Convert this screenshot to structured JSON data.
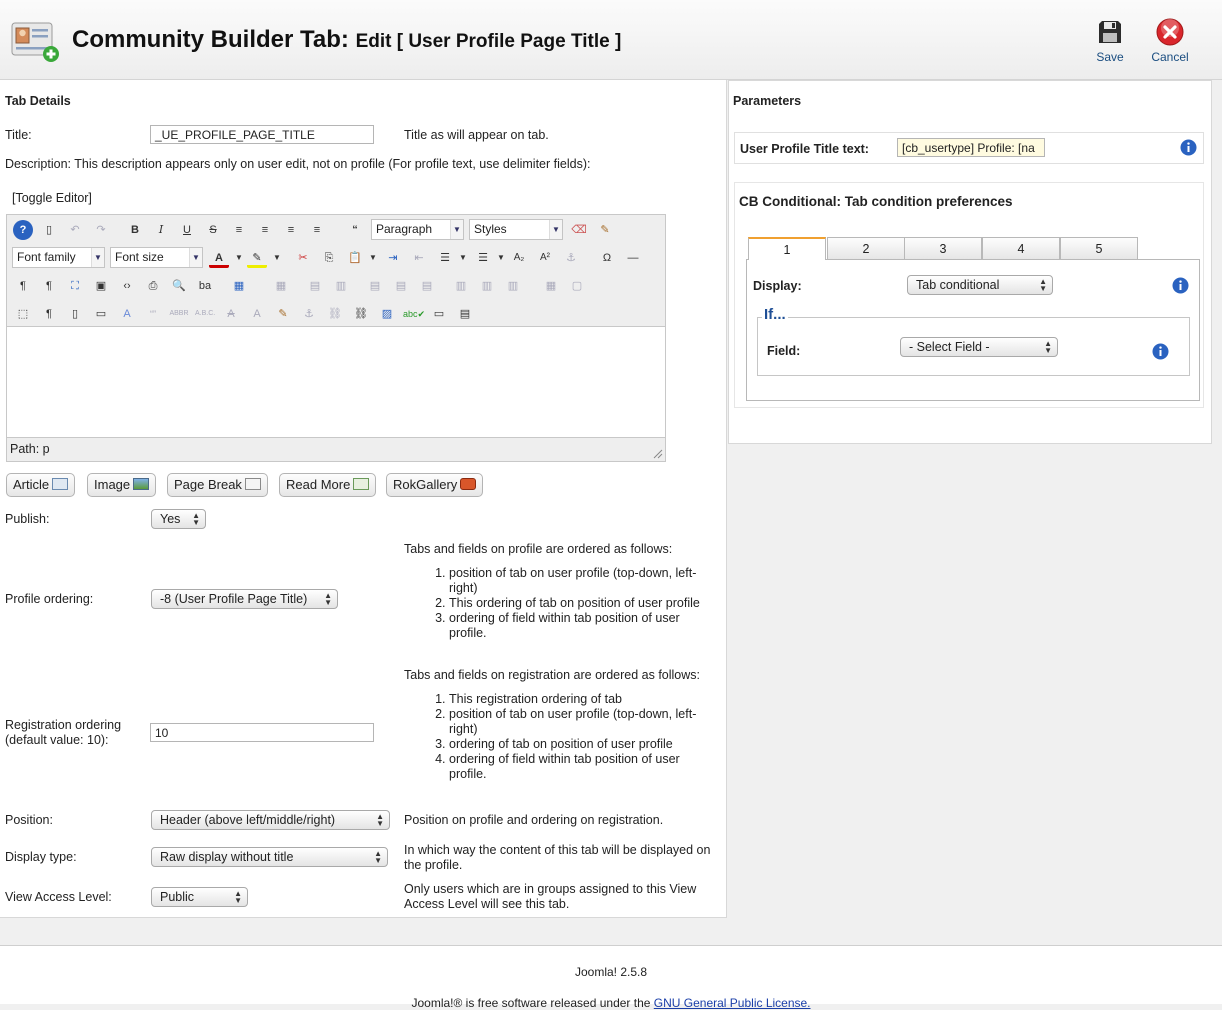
{
  "header": {
    "title": "Community Builder Tab:",
    "subtitle": "Edit [ User Profile Page Title ]",
    "save_label": "Save",
    "cancel_label": "Cancel"
  },
  "tab_details": {
    "heading": "Tab Details",
    "title_label": "Title:",
    "title_value": "_UE_PROFILE_PAGE_TITLE",
    "title_hint": "Title as will appear on tab.",
    "description_label": "Description: This description appears only on user edit, not on profile (For profile text, use delimiter fields):",
    "toggle_editor": "[Toggle Editor]"
  },
  "editor": {
    "paragraph_select": "Paragraph",
    "styles_select": "Styles",
    "font_family_select": "Font family",
    "font_size_select": "Font size",
    "path_label": "Path:",
    "path_value": "p"
  },
  "editor_buttons": [
    "Article",
    "Image",
    "Page Break",
    "Read More",
    "RokGallery"
  ],
  "publish": {
    "label": "Publish:",
    "value": "Yes"
  },
  "profile_ordering": {
    "label": "Profile ordering:",
    "value": "-8 (User Profile Page Title)",
    "intro": "Tabs and fields on profile are ordered as follows:",
    "items": [
      "position of tab on user profile (top-down, left-right)",
      "This ordering of tab on position of user profile",
      "ordering of field within tab position of user profile."
    ]
  },
  "registration_ordering": {
    "label_line1": "Registration ordering",
    "label_line2": "(default value: 10):",
    "value": "10",
    "intro": "Tabs and fields on registration are ordered as follows:",
    "items": [
      "This registration ordering of tab",
      "position of tab on user profile (top-down, left-right)",
      "ordering of tab on position of user profile",
      "ordering of field within tab position of user profile."
    ]
  },
  "position": {
    "label": "Position:",
    "value": "Header (above left/middle/right)",
    "hint": "Position on profile and ordering on registration."
  },
  "display_type": {
    "label": "Display type:",
    "value": "Raw display without title",
    "hint": "In which way the content of this tab will be displayed on the profile."
  },
  "view_access": {
    "label": "View Access Level:",
    "value": "Public",
    "hint": "Only users which are in groups assigned to this View Access Level will see this tab."
  },
  "parameters": {
    "heading": "Parameters",
    "profile_title_label": "User Profile Title text:",
    "profile_title_value": "[cb_usertype] Profile: [na",
    "conditional_heading": "CB Conditional: Tab condition preferences",
    "tabs": [
      "1",
      "2",
      "3",
      "4",
      "5"
    ],
    "display_label": "Display:",
    "display_value": "Tab conditional",
    "if_legend": "If...",
    "field_label": "Field:",
    "field_value": "- Select Field -"
  },
  "footer": {
    "version": "Joomla! 2.5.8",
    "license_text": "Joomla!® is free software released under the",
    "license_link": "GNU General Public License."
  },
  "colors": {
    "link_blue": "#1a4d80",
    "legend_blue": "#1f4f96",
    "cancel_red": "#d9262c",
    "active_tab_accent": "#f0a030"
  }
}
